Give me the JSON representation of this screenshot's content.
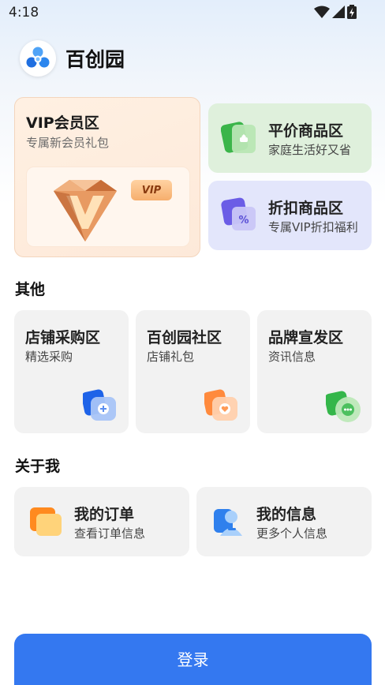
{
  "status_bar": {
    "time": "4:18",
    "icons": [
      "wifi-icon",
      "cell-signal-icon",
      "battery-charging-icon"
    ]
  },
  "header": {
    "title": "百创园",
    "logo_icon": "baichuangyuan-logo"
  },
  "vip": {
    "title": "VIP会员区",
    "subtitle": "专属新会员礼包",
    "badge": "VIP"
  },
  "promos": [
    {
      "title": "平价商品区",
      "subtitle": "家庭生活好又省",
      "icon": "shopping-tag-icon",
      "color": "#dff0dc"
    },
    {
      "title": "折扣商品区",
      "subtitle": "专属VIP折扣福利",
      "icon": "discount-percent-icon",
      "color": "#e3e6fb"
    }
  ],
  "other": {
    "heading": "其他",
    "tiles": [
      {
        "title": "店铺采购区",
        "subtitle": "精选采购",
        "icon": "plus-card-icon",
        "color": "#1e63e8"
      },
      {
        "title": "百创园社区",
        "subtitle": "店铺礼包",
        "icon": "heart-card-icon",
        "color": "#ff8a3d"
      },
      {
        "title": "品牌宣发区",
        "subtitle": "资讯信息",
        "icon": "chat-bubble-icon",
        "color": "#34b64a"
      }
    ]
  },
  "about": {
    "heading": "关于我",
    "cards": [
      {
        "title": "我的订单",
        "subtitle": "查看订单信息",
        "icon": "orders-icon"
      },
      {
        "title": "我的信息",
        "subtitle": "更多个人信息",
        "icon": "user-profile-icon"
      }
    ]
  },
  "login": {
    "label": "登录"
  }
}
